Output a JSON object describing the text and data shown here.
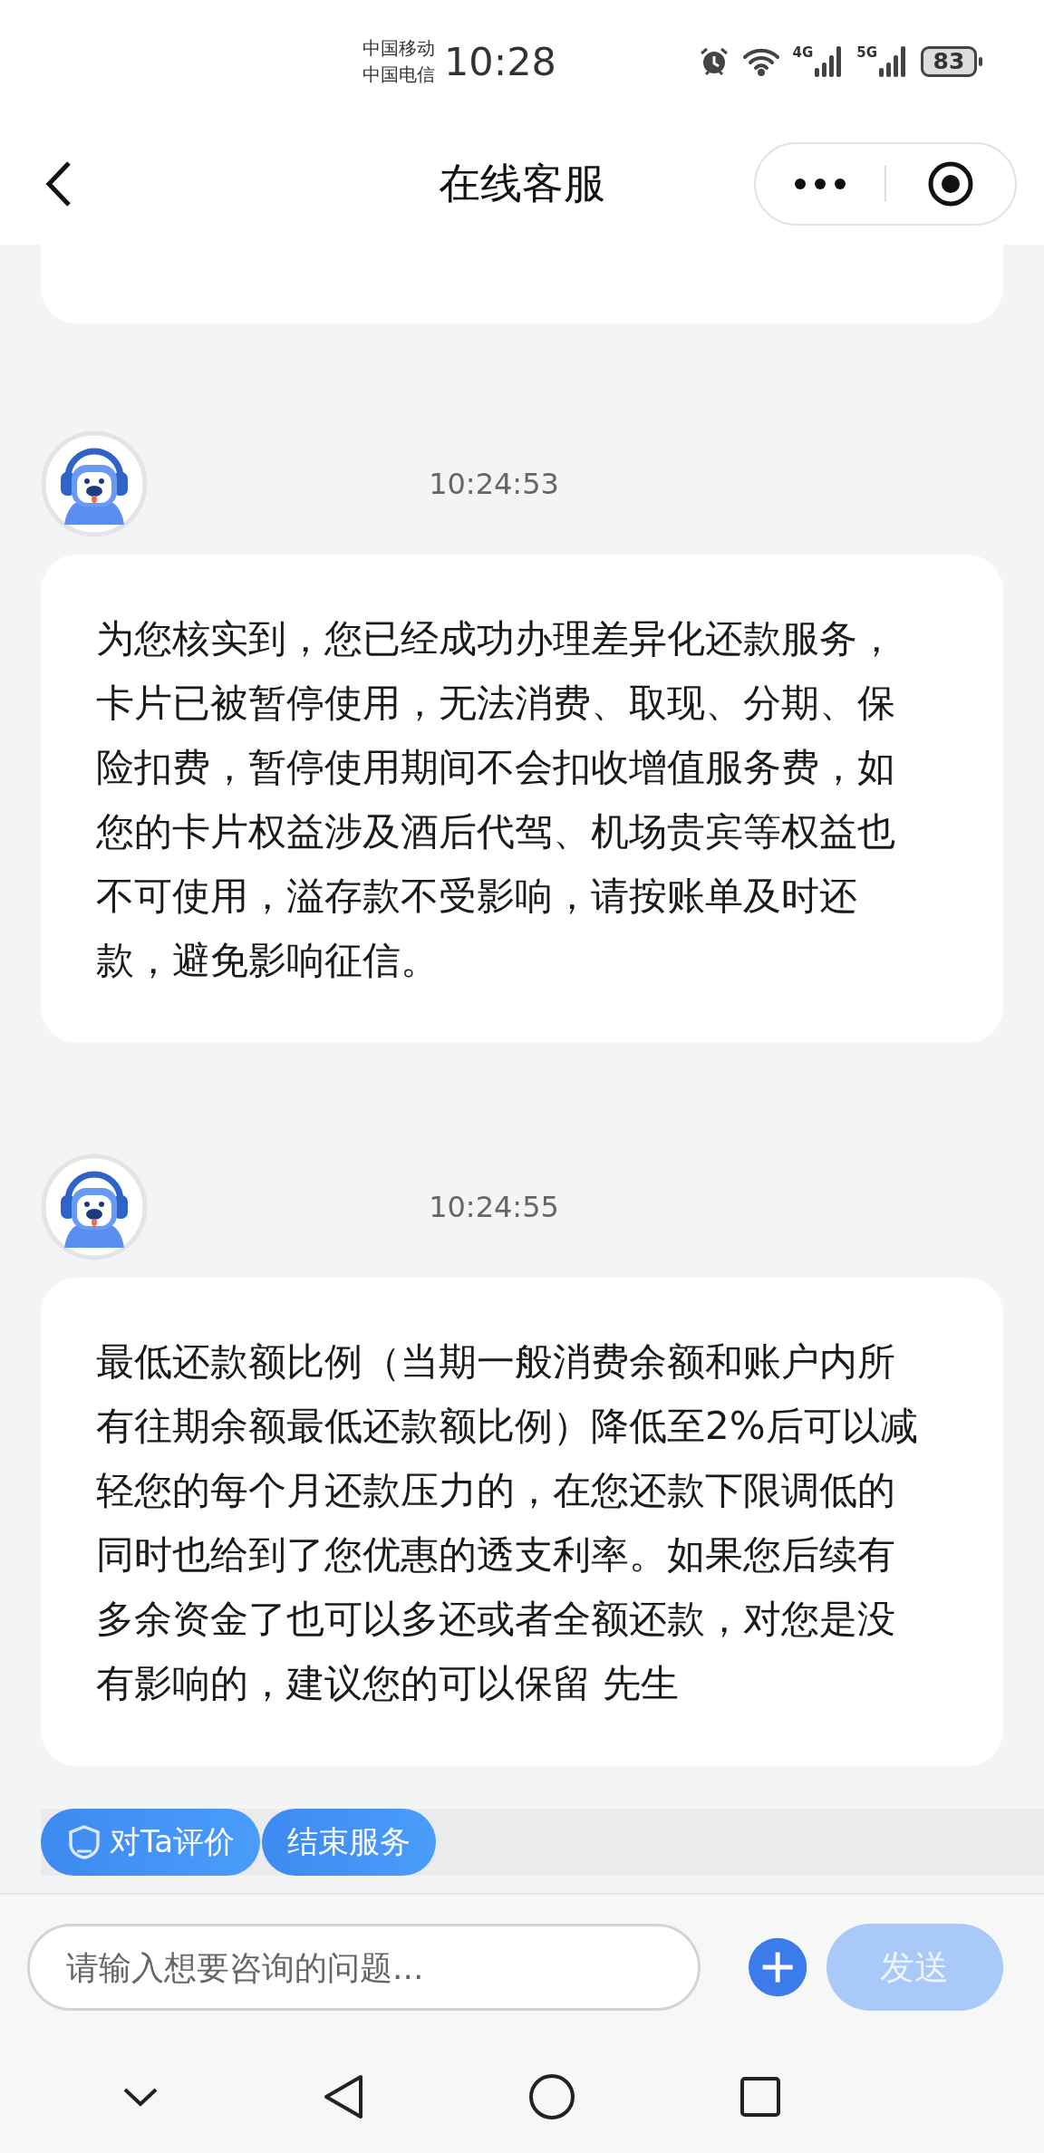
{
  "status_bar": {
    "carriers": [
      "中国移动",
      "中国电信"
    ],
    "time": "10:28",
    "networks": [
      "4G",
      "5G"
    ],
    "battery": "83"
  },
  "header": {
    "title": "在线客服"
  },
  "messages": [
    {
      "time": "10:24:53",
      "text": "为您核实到，您已经成功办理差异化还款服务，卡片已被暂停使用，无法消费、取现、分期、保险扣费，暂停使用期间不会扣收增值服务费，如您的卡片权益涉及酒后代驾、机场贵宾等权益也不可使用，溢存款不受影响，请按账单及时还款，避免影响征信。"
    },
    {
      "time": "10:24:55",
      "text": "最低还款额比例（当期一般消费余额和账户内所有往期余额最低还款额比例）降低至2%后可以减轻您的每个月还款压力的，在您还款下限调低的同时也给到了您优惠的透支利率。如果您后续有多余资金了也可以多还或者全额还款，对您是没有影响的，建议您的可以保留 先生"
    }
  ],
  "quick_actions": [
    {
      "label": "对Ta评价",
      "kind": "rate"
    },
    {
      "label": "结束服务",
      "kind": "plain"
    }
  ],
  "composer": {
    "placeholder": "请输入想要咨询的问题...",
    "send": {
      "label": "发送",
      "disabled": true
    }
  }
}
